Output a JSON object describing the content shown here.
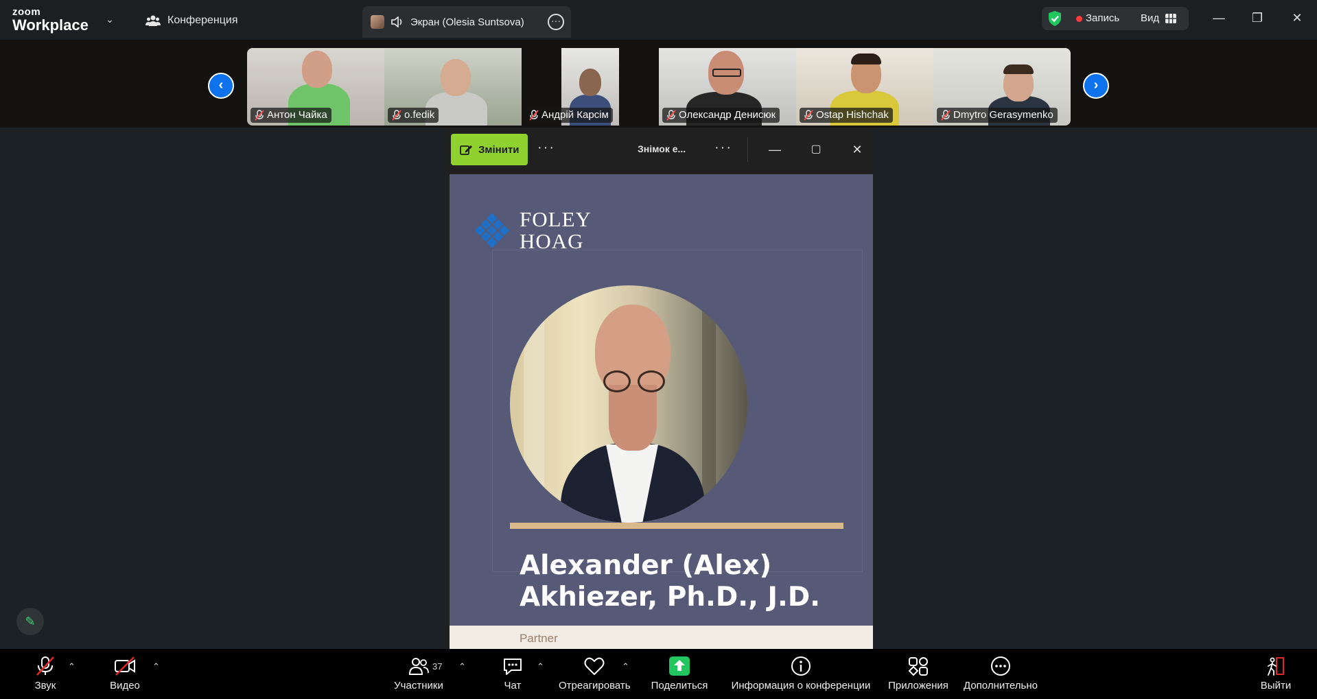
{
  "titlebar": {
    "brand_top": "zoom",
    "brand_bottom": "Workplace",
    "meeting_tab": "Конференция",
    "screen_tab": "Экран (Olesia Suntsova)",
    "record_label": "Запись",
    "view_label": "Вид"
  },
  "participants_strip": [
    {
      "name": "Антон Чайка"
    },
    {
      "name": "o.fedik"
    },
    {
      "name": "Андрій Карсім"
    },
    {
      "name": "Олександр Денисюк"
    },
    {
      "name": "Ostap Hishchak"
    },
    {
      "name": "Dmytro Gerasymenko"
    }
  ],
  "share_window": {
    "edit_button": "Змінити",
    "title": "Знімок е...",
    "slide": {
      "logo_line1": "FOLEY",
      "logo_line2": "HOAG",
      "name_line1": "Alexander (Alex)",
      "name_line2": "Akhiezer, Ph.D., J.D.",
      "role": "Partner"
    }
  },
  "toolbar": {
    "audio": "Звук",
    "video": "Видео",
    "participants": "Участники",
    "participants_count": "37",
    "chat": "Чат",
    "react": "Отреагировать",
    "share": "Поделиться",
    "info": "Информация о конференции",
    "apps": "Приложения",
    "more": "Дополнительно",
    "leave": "Выйти"
  },
  "colors": {
    "accent_blue": "#0e72ed",
    "share_green": "#22c55e",
    "edit_green": "#8fd12e",
    "record_red": "#ff3b3b",
    "leave_red": "#e02828"
  }
}
